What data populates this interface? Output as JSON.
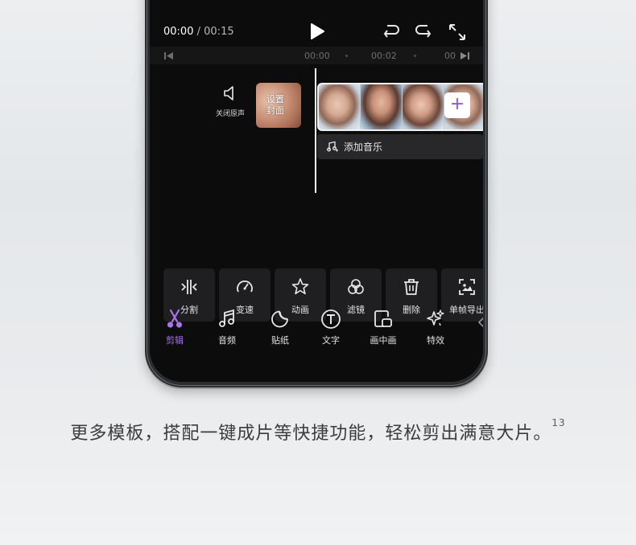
{
  "player": {
    "current_time": "00:00",
    "separator": "/",
    "total_time": "00:15"
  },
  "ruler": {
    "ticks": [
      "00:00",
      "00:02",
      "00"
    ]
  },
  "timeline": {
    "mute_label": "关闭原声",
    "cover_label_line1": "设置",
    "cover_label_line2": "封面",
    "add_clip_symbol": "+",
    "add_music_label": "添加音乐"
  },
  "tools": [
    {
      "label": "分割",
      "icon": "split-icon"
    },
    {
      "label": "变速",
      "icon": "speed-gauge-icon"
    },
    {
      "label": "动画",
      "icon": "star-animation-icon"
    },
    {
      "label": "滤镜",
      "icon": "filter-circles-icon"
    },
    {
      "label": "删除",
      "icon": "trash-icon"
    },
    {
      "label": "单帧导出",
      "icon": "frame-export-icon"
    }
  ],
  "nav": [
    {
      "label": "剪辑",
      "icon": "scissors-icon",
      "active": true
    },
    {
      "label": "音频",
      "icon": "music-note-icon"
    },
    {
      "label": "贴纸",
      "icon": "sticker-icon"
    },
    {
      "label": "文字",
      "icon": "text-icon"
    },
    {
      "label": "画中画",
      "icon": "picture-in-picture-icon"
    },
    {
      "label": "特效",
      "icon": "effects-sparkle-icon"
    }
  ],
  "colors": {
    "accent": "#a874f0",
    "screen_bg": "#0c0c0d",
    "button_bg": "#1f1f21"
  },
  "caption": {
    "text": "更多模板，搭配一键成片等快捷功能，轻松剪出满意大片。",
    "footnote": "13"
  }
}
